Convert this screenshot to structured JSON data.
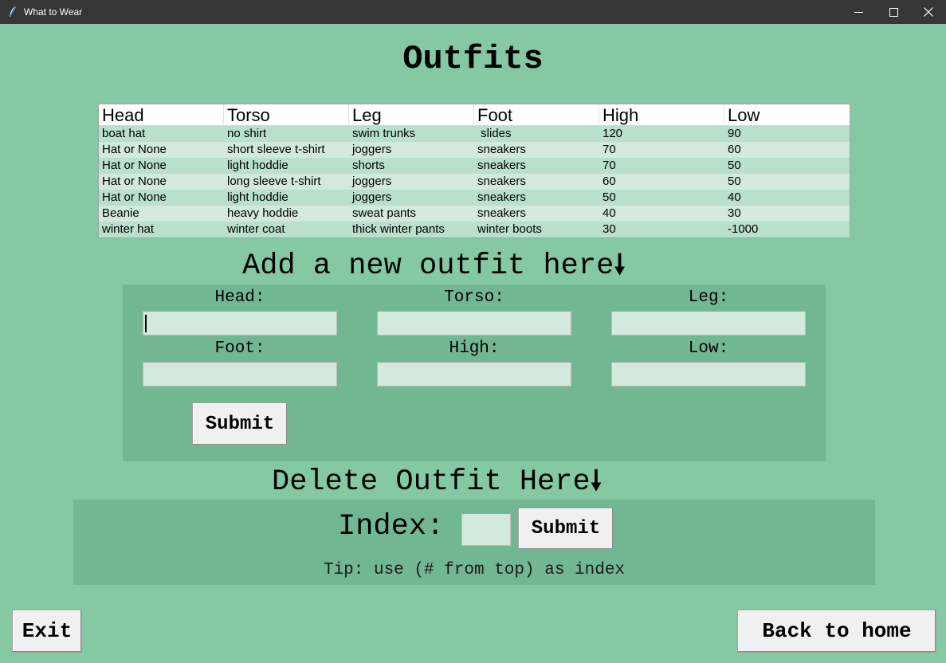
{
  "window": {
    "title": "What to Wear"
  },
  "page": {
    "title": "Outfits"
  },
  "table": {
    "headers": [
      "Head",
      "Torso",
      "Leg",
      "Foot",
      "High",
      "Low"
    ],
    "rows": [
      [
        "boat hat",
        "no shirt",
        "swim trunks",
        " slides",
        "120",
        "90"
      ],
      [
        "Hat or None",
        "short sleeve t-shirt",
        "joggers",
        "sneakers",
        "70",
        "60"
      ],
      [
        "Hat or None",
        "light hoddie",
        "shorts",
        "sneakers",
        "70",
        "50"
      ],
      [
        "Hat or None",
        "long sleeve t-shirt",
        "joggers",
        "sneakers",
        "60",
        "50"
      ],
      [
        "Hat or None",
        "light hoddie",
        "joggers",
        "sneakers",
        "50",
        "40"
      ],
      [
        "Beanie",
        "heavy hoddie",
        "sweat pants",
        "sneakers",
        "40",
        "30"
      ],
      [
        "winter hat",
        "winter coat",
        "thick winter pants",
        "winter boots",
        "30",
        "-1000"
      ]
    ]
  },
  "add_section": {
    "heading": "Add a new outfit here",
    "arrow": "🠗",
    "fields": {
      "head": {
        "label": "Head:",
        "value": ""
      },
      "torso": {
        "label": "Torso:",
        "value": ""
      },
      "leg": {
        "label": "Leg:",
        "value": ""
      },
      "foot": {
        "label": "Foot:",
        "value": ""
      },
      "high": {
        "label": "High:",
        "value": ""
      },
      "low": {
        "label": "Low:",
        "value": ""
      }
    },
    "submit_label": "Submit"
  },
  "delete_section": {
    "heading": "Delete Outfit Here",
    "arrow": "🠗",
    "index_label": "Index:",
    "index_value": "",
    "submit_label": "Submit",
    "tip": "Tip: use (# from top) as index"
  },
  "footer": {
    "exit_label": "Exit",
    "back_label": "Back to home"
  }
}
